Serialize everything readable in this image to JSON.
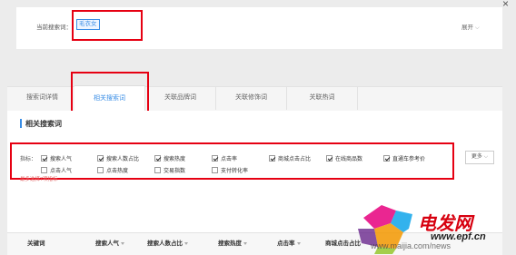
{
  "top": {
    "current_label": "当前搜索词：",
    "current_value": "毛衣女",
    "expand_label": "展开"
  },
  "tabs": [
    "搜索词详情",
    "相关搜索词",
    "关联品牌词",
    "关联修饰词",
    "关联热词"
  ],
  "section_title": "相关搜索词",
  "metrics": {
    "label": "指标：",
    "row1": [
      {
        "label": "搜索人气",
        "checked": true
      },
      {
        "label": "搜索人数占比",
        "checked": true
      },
      {
        "label": "搜索热度",
        "checked": true
      },
      {
        "label": "点击率",
        "checked": true
      },
      {
        "label": "商城点击占比",
        "checked": true
      },
      {
        "label": "在线商品数",
        "checked": true
      },
      {
        "label": "直通车参考价",
        "checked": true
      }
    ],
    "row2": [
      {
        "label": "点击人气",
        "checked": false
      },
      {
        "label": "点击热度",
        "checked": false
      },
      {
        "label": "交易指数",
        "checked": false
      },
      {
        "label": "支付转化率",
        "checked": false
      }
    ],
    "hint": "最多选择7项指标",
    "more_label": "更多"
  },
  "table": {
    "headers": [
      "关键词",
      "搜索人气",
      "搜索人数占比",
      "搜索热度",
      "点击率",
      "商城点击占比"
    ]
  },
  "watermark": {
    "brand": "电发网",
    "url": "www.epf.cn",
    "partial": "www.maijia.com/news"
  },
  "colors": {
    "highlight_red": "#e60012",
    "accent_blue": "#3a8ee6"
  }
}
